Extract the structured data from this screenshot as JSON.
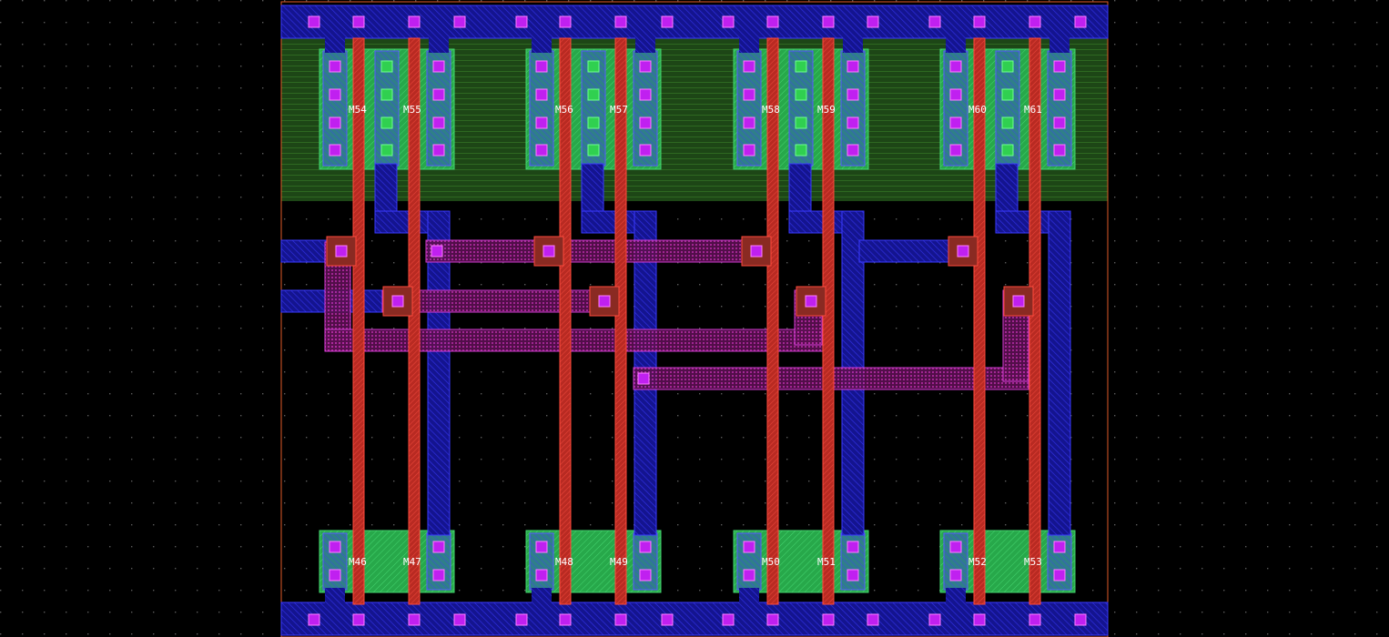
{
  "view": {
    "title": "",
    "grid": "dotted"
  },
  "colors": {
    "background": "#000000",
    "grid_dot": "#5a5a5a",
    "nwell_fill": "#2a6a1e",
    "ndiff_fill": "#2fbf55",
    "poly": "#e0332a",
    "metal1": "#1a1ad0",
    "metal2": "#d020d0",
    "contact": "#c020f0",
    "label": "#ffffff",
    "cell_boundary": "#e05a28"
  },
  "labels": {
    "pmos_row": [
      "M54",
      "M55",
      "M56",
      "M57",
      "M58",
      "M59",
      "M60",
      "M61"
    ],
    "nmos_row": [
      "M46",
      "M47",
      "M48",
      "M49",
      "M50",
      "M51",
      "M52",
      "M53"
    ]
  }
}
